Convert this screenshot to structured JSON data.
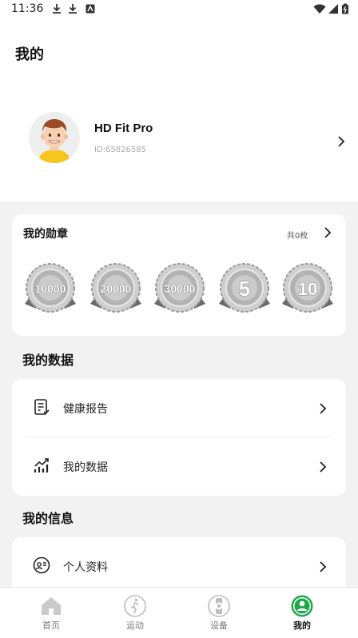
{
  "status_bar": {
    "time": "11:36"
  },
  "header": {
    "title": "我的"
  },
  "profile": {
    "name": "HD Fit Pro",
    "id": "ID:65826585"
  },
  "badges": {
    "title": "我的勋章",
    "count_label": "共0枚",
    "medals": [
      "10000",
      "20000",
      "30000",
      "5",
      "10"
    ]
  },
  "my_data": {
    "title": "我的数据",
    "items": [
      {
        "label": "健康报告",
        "icon": "report-icon"
      },
      {
        "label": "我的数据",
        "icon": "chart-icon"
      }
    ]
  },
  "my_info": {
    "title": "我的信息",
    "items": [
      {
        "label": "个人资料",
        "icon": "profile-card-icon"
      }
    ]
  },
  "tabs": [
    {
      "label": "首页",
      "icon": "home-icon",
      "active": false
    },
    {
      "label": "运动",
      "icon": "run-icon",
      "active": false
    },
    {
      "label": "设备",
      "icon": "watch-icon",
      "active": false
    },
    {
      "label": "我的",
      "icon": "user-icon",
      "active": true
    }
  ],
  "colors": {
    "accent": "#1ea84a",
    "background": "#f2f2f2",
    "card": "#ffffff"
  }
}
